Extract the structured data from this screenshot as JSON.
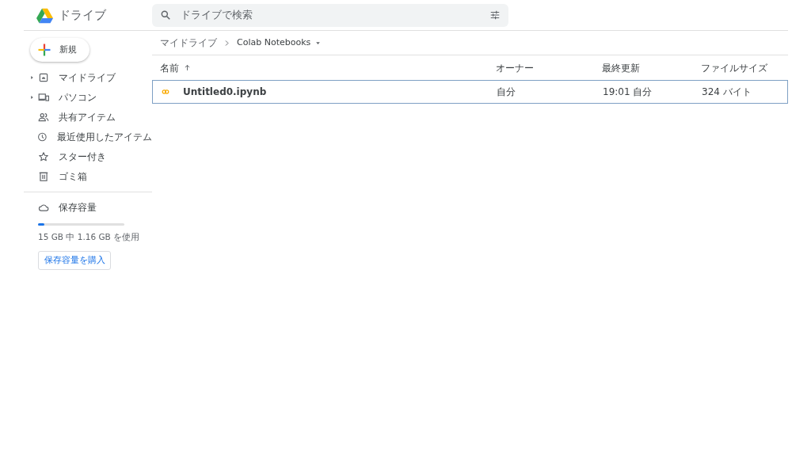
{
  "app": {
    "title": "ドライブ"
  },
  "search": {
    "placeholder": "ドライブで検索"
  },
  "new_button": {
    "label": "新規"
  },
  "sidebar": {
    "items": [
      {
        "label": "マイドライブ",
        "kind": "drive",
        "expandable": true,
        "selected": false
      },
      {
        "label": "パソコン",
        "kind": "computer",
        "expandable": true,
        "selected": false
      },
      {
        "label": "共有アイテム",
        "kind": "people",
        "expandable": false,
        "selected": false
      },
      {
        "label": "最近使用したアイテム",
        "kind": "clock",
        "expandable": false,
        "selected": false
      },
      {
        "label": "スター付き",
        "kind": "star",
        "expandable": false,
        "selected": false
      },
      {
        "label": "ゴミ箱",
        "kind": "trash",
        "expandable": false,
        "selected": false
      }
    ]
  },
  "storage": {
    "label": "保存容量",
    "level": 0.07,
    "usage": "15 GB 中 1.16 GB を使用",
    "buy_button": "保存容量を購入"
  },
  "breadcrumb": [
    "マイドライブ",
    "Colab Notebooks"
  ],
  "table": {
    "columns": [
      "名前",
      "オーナー",
      "最終更新",
      "ファイルサイズ"
    ],
    "rows": [
      {
        "cells": [
          "Untitled0.ipynb",
          "自分",
          "19:01 自分",
          "324 バイト"
        ],
        "selected": true
      }
    ]
  }
}
